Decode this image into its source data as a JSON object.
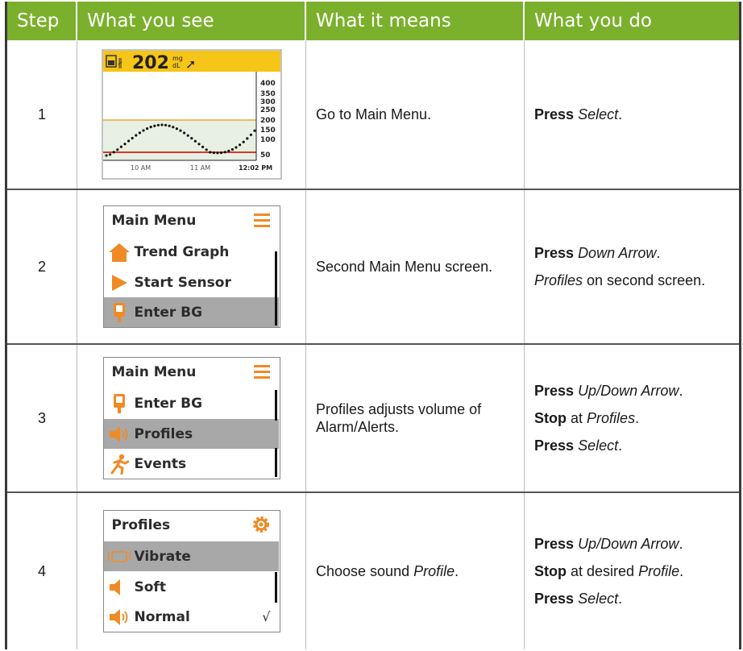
{
  "header": {
    "step": "Step",
    "see": "What you see",
    "means": "What it means",
    "do": "What you do"
  },
  "rows": [
    {
      "num": "1",
      "means": "Go to Main Menu.",
      "do": [
        {
          "b": "Press",
          "i": "Select",
          "t": "."
        }
      ]
    },
    {
      "num": "2",
      "means": "Second Main Menu screen.",
      "do": [
        {
          "b": "Press",
          "i": "Down Arrow",
          "t": "."
        }
      ],
      "do_extra": {
        "i": "Profiles",
        "t": " on second screen."
      }
    },
    {
      "num": "3",
      "means": "Profiles adjusts volume of Alarm/Alerts.",
      "do": [
        {
          "b": "Press",
          "i": "Up/Down Arrow",
          "t": "."
        },
        {
          "b": "Stop",
          "pre": "at",
          "i": "Profiles",
          "t": "."
        },
        {
          "b": "Press",
          "i": "Select",
          "t": "."
        }
      ]
    },
    {
      "num": "4",
      "means_pre": "Choose sound ",
      "means_i": "Profile",
      "means_post": ".",
      "do": [
        {
          "b": "Press",
          "i": "Up/Down Arrow",
          "t": "."
        },
        {
          "b": "Stop",
          "pre": "at desired",
          "i": "Profile",
          "t": "."
        },
        {
          "b": "Press",
          "i": "Select",
          "t": "."
        }
      ]
    }
  ],
  "trend": {
    "glucose": "202",
    "unit_top": "mg",
    "unit_bottom": "dL",
    "y_ticks": [
      "400",
      "350",
      "300",
      "250",
      "200",
      "150",
      "100",
      "50"
    ],
    "x_ticks": [
      "10 AM",
      "11 AM",
      "12:02 PM"
    ]
  },
  "menu2": {
    "title": "Main Menu",
    "items": [
      "Trend Graph",
      "Start Sensor",
      "Enter BG"
    ]
  },
  "menu3": {
    "title": "Main Menu",
    "items": [
      "Enter BG",
      "Profiles",
      "Events"
    ]
  },
  "menu4": {
    "title": "Profiles",
    "items": [
      "Vibrate",
      "Soft",
      "Normal"
    ],
    "check": "√"
  },
  "colors": {
    "header": "#7bb02c",
    "accent": "#f08a24",
    "yellow": "#f5c518",
    "selected": "#a8a8a8"
  }
}
